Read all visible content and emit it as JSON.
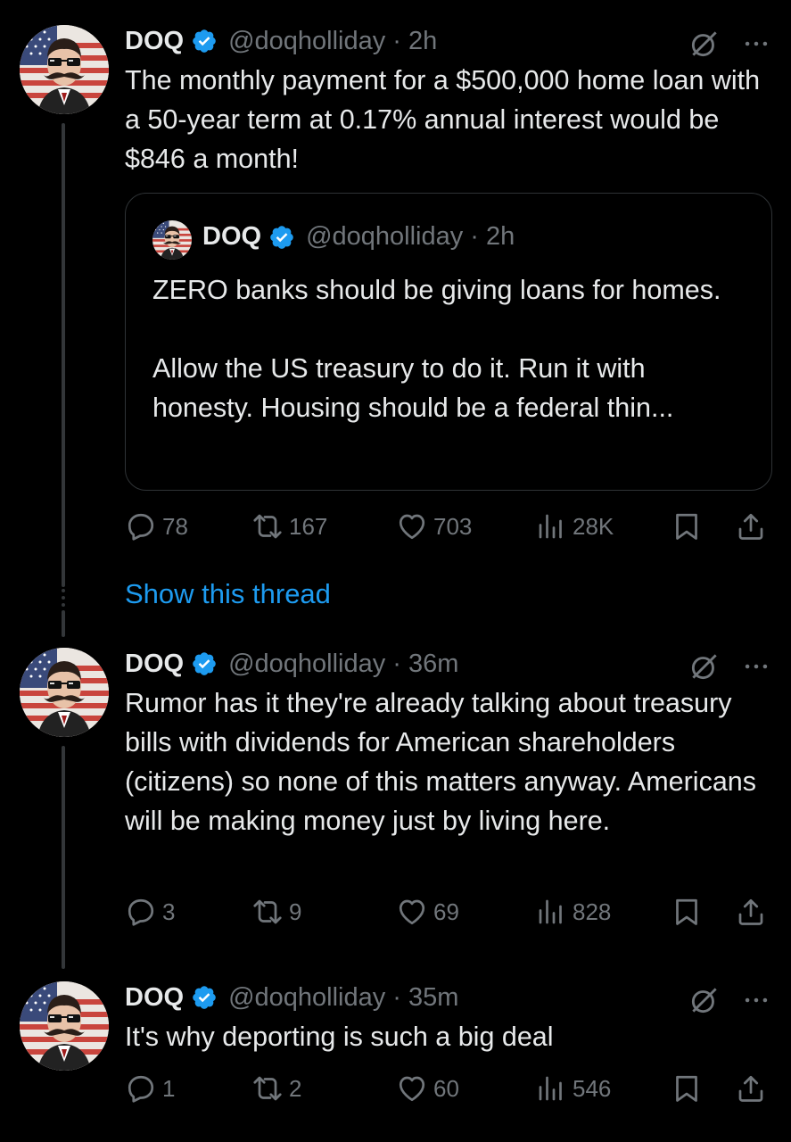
{
  "colors": {
    "background": "#000000",
    "text": "#e7e9ea",
    "muted": "#71767b",
    "link": "#1d9bf0",
    "verified": "#1d9bf0",
    "border": "#2f3336"
  },
  "tweets": [
    {
      "name": "DOQ",
      "handle": "@doqholliday",
      "time": "2h",
      "text": "The monthly payment for a $500,000 home loan with a 50-year term at 0.17% annual interest would be $846 a month!",
      "quote": {
        "name": "DOQ",
        "handle": "@doqholliday",
        "time": "2h",
        "text": "ZERO banks should be giving loans for homes.\n\nAllow the US treasury to do it. Run it with honesty. Housing should be a federal thin..."
      },
      "stats": {
        "replies": "78",
        "reposts": "167",
        "likes": "703",
        "views": "28K"
      }
    },
    {
      "name": "DOQ",
      "handle": "@doqholliday",
      "time": "36m",
      "text": "Rumor has it they're already talking about treasury bills with dividends for American shareholders (citizens) so none of this matters anyway. Americans will be making money just by living here.",
      "stats": {
        "replies": "3",
        "reposts": "9",
        "likes": "69",
        "views": "828"
      }
    },
    {
      "name": "DOQ",
      "handle": "@doqholliday",
      "time": "35m",
      "text": "It's why deporting is such a big deal",
      "stats": {
        "replies": "1",
        "reposts": "2",
        "likes": "60",
        "views": "546"
      }
    }
  ],
  "show_thread": "Show this thread",
  "icons": {
    "verified": "verified-badge-icon",
    "grok": "grok-icon",
    "more": "more-icon",
    "reply": "reply-icon",
    "repost": "repost-icon",
    "like": "heart-icon",
    "views": "views-icon",
    "bookmark": "bookmark-icon",
    "share": "share-icon"
  }
}
